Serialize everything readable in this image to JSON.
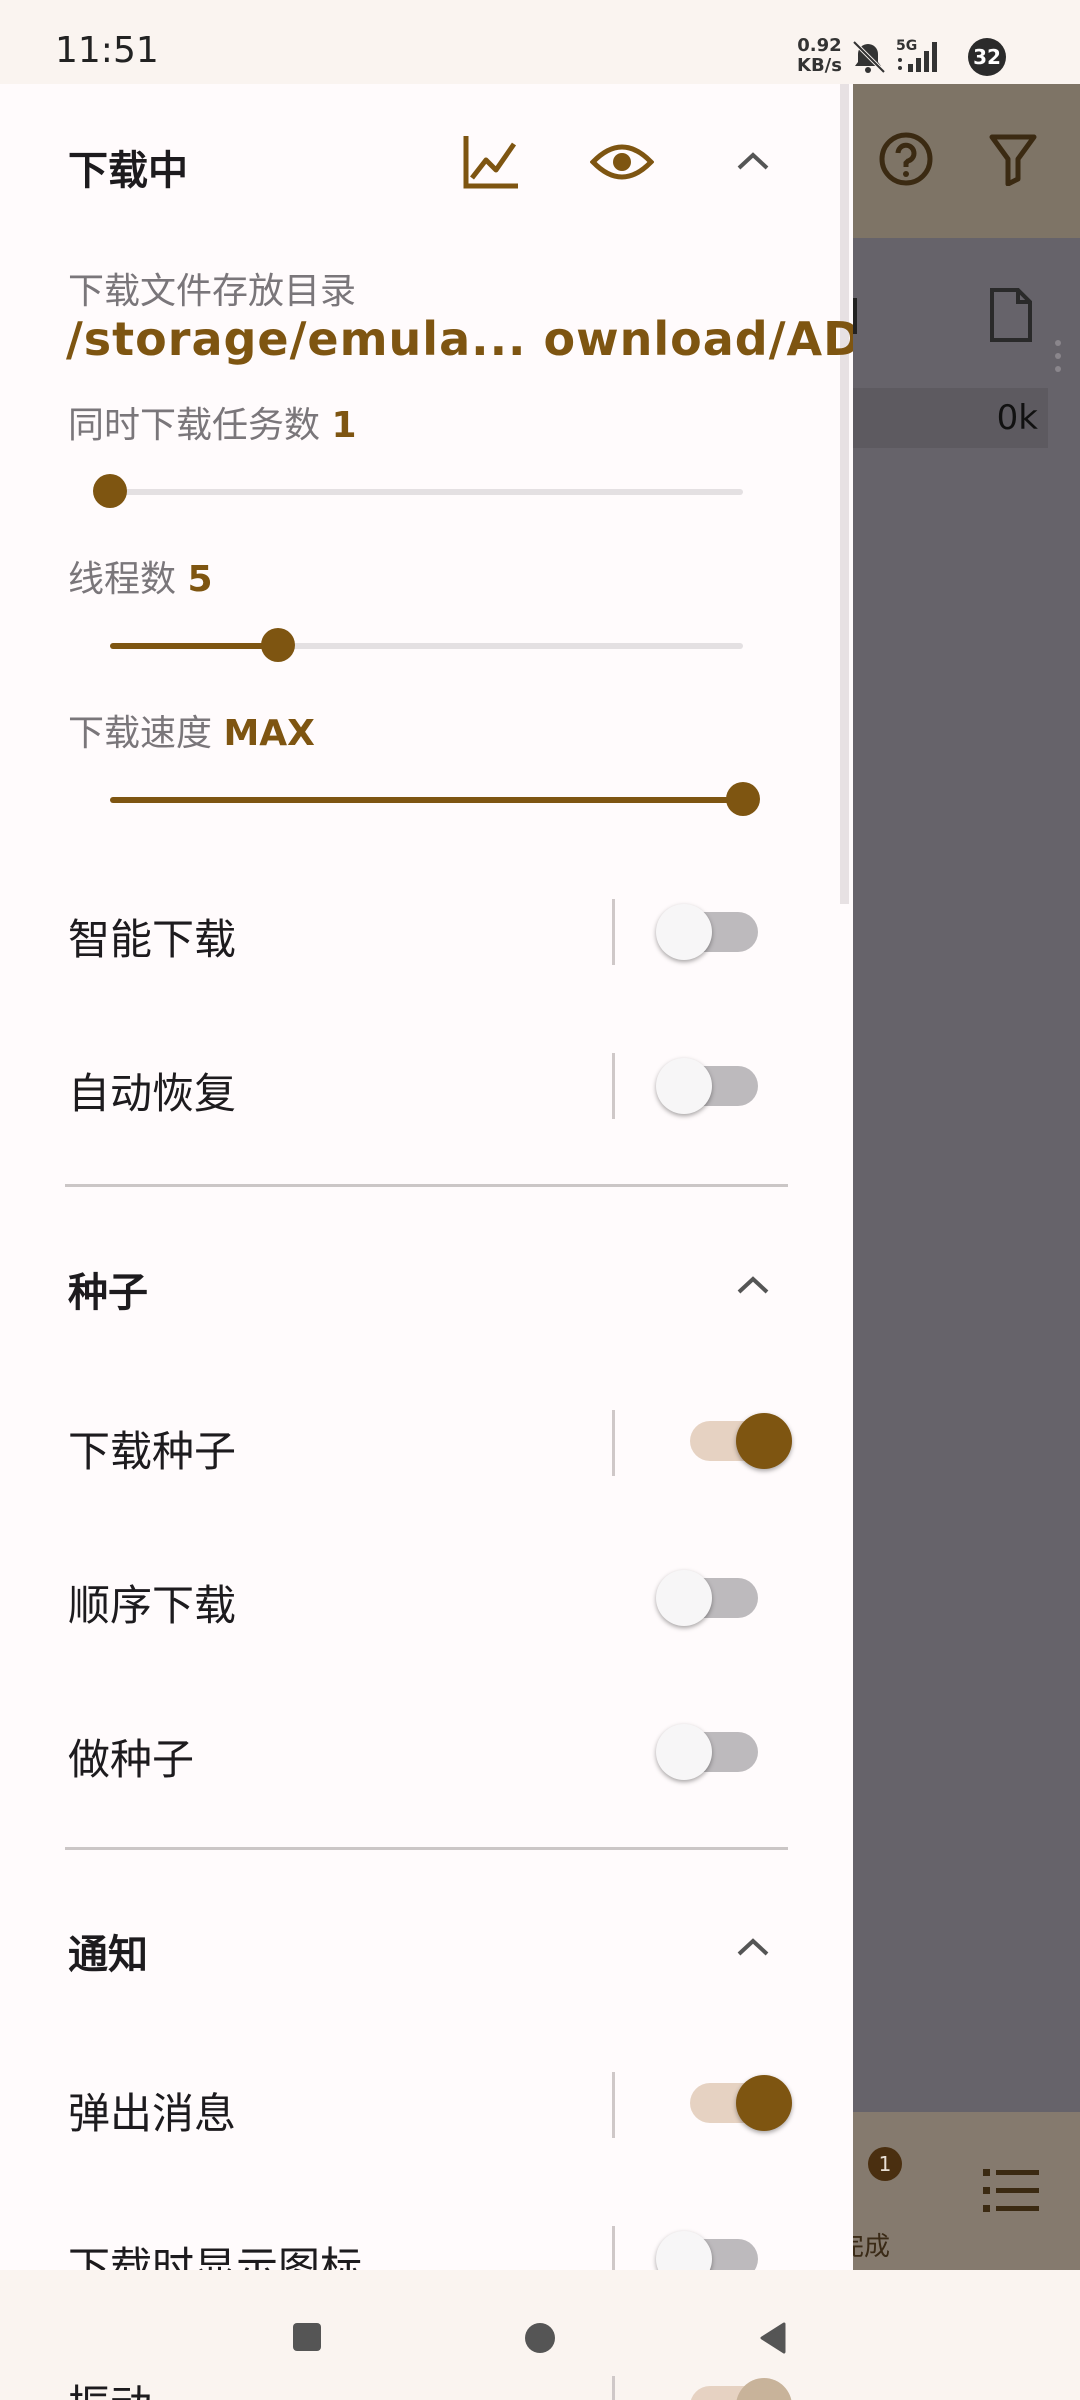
{
  "status_bar": {
    "time": "11:51",
    "net_speed_value": "0.92",
    "net_speed_unit": "KB/s",
    "network": "5G",
    "badge_count": "32"
  },
  "background_app": {
    "size_text": "0k",
    "tab_badge": "1",
    "tab_done_partial": "完成"
  },
  "drawer": {
    "downloading": {
      "title": "下载中",
      "folder_label": "下载文件存放目录",
      "folder_path": "/storage/emula... ownload/ADM",
      "concurrent_label": "同时下载任务数",
      "concurrent_value": "1",
      "threads_label": "线程数",
      "threads_value": "5",
      "speed_label": "下载速度",
      "speed_value": "MAX",
      "smart_label": "智能下载",
      "auto_resume_label": "自动恢复"
    },
    "sliders": {
      "concurrent_fraction": 0.0,
      "threads_fraction": 0.265,
      "speed_fraction": 1.0
    },
    "toggles": {
      "smart": false,
      "auto_resume": false,
      "download_torrent": true,
      "sequential": false,
      "make_torrent": false,
      "popup": true,
      "show_icon": false
    },
    "torrent": {
      "title": "种子",
      "download_label": "下载种子",
      "sequential_label": "顺序下载",
      "make_label": "做种子"
    },
    "notify": {
      "title": "通知",
      "popup_label": "弹出消息",
      "icon_label": "下载时显示图标",
      "vibrate_label": "振动"
    }
  },
  "colors": {
    "accent": "#7e5511",
    "drawer_bg": "#fffbfc",
    "scrim": "#66636a"
  }
}
